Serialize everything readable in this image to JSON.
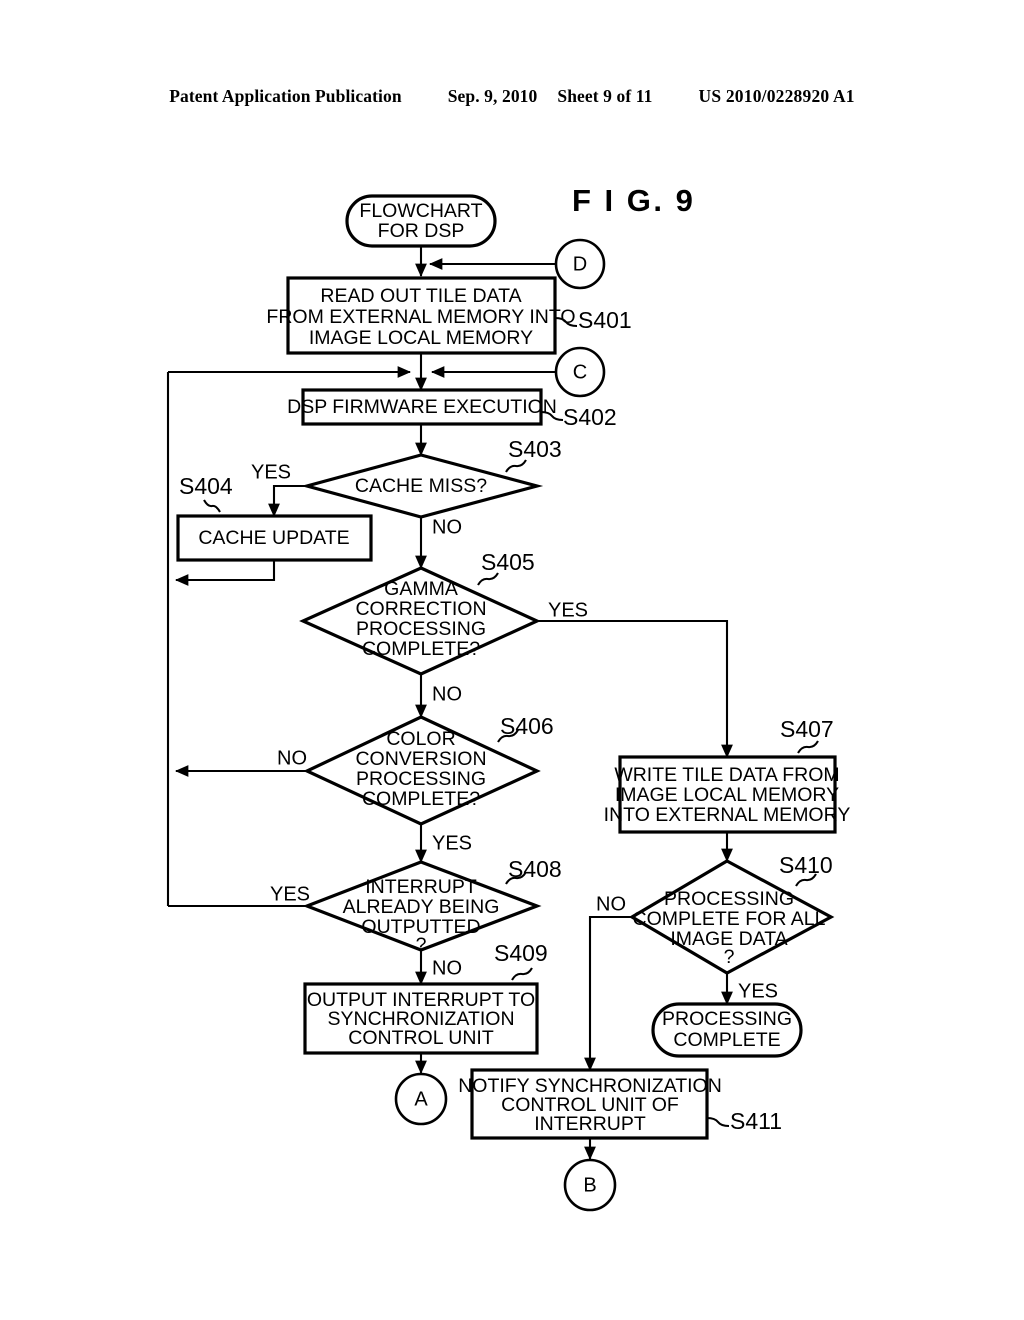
{
  "header": {
    "publication": "Patent Application Publication",
    "date": "Sep. 9, 2010",
    "sheet": "Sheet 9 of 11",
    "number": "US 2010/0228920 A1"
  },
  "figure": {
    "title": "F I G.  9"
  },
  "flowchart": {
    "start": {
      "id": "start",
      "type": "terminator",
      "label_line1": "FLOWCHART",
      "label_line2": "FOR DSP"
    },
    "end": {
      "id": "end",
      "type": "terminator",
      "label_line1": "PROCESSING",
      "label_line2": "COMPLETE"
    },
    "connectors": [
      {
        "id": "conn-d",
        "label": "D"
      },
      {
        "id": "conn-c",
        "label": "C"
      },
      {
        "id": "conn-a",
        "label": "A"
      },
      {
        "id": "conn-b",
        "label": "B"
      }
    ],
    "steps": [
      {
        "id": "s401",
        "step": "S401",
        "type": "process",
        "lines": [
          "READ OUT TILE DATA",
          "FROM  EXTERNAL MEMORY INTO",
          "IMAGE LOCAL MEMORY"
        ]
      },
      {
        "id": "s402",
        "step": "S402",
        "type": "process",
        "lines": [
          "DSP FIRMWARE EXECUTION"
        ]
      },
      {
        "id": "s403",
        "step": "S403",
        "type": "decision",
        "lines": [
          "CACHE MISS?"
        ],
        "branches": {
          "yes": "YES",
          "no": "NO"
        }
      },
      {
        "id": "s404",
        "step": "S404",
        "type": "process",
        "lines": [
          "CACHE UPDATE"
        ]
      },
      {
        "id": "s405",
        "step": "S405",
        "type": "decision",
        "lines": [
          "GAMMA",
          "CORRECTION",
          "PROCESSING",
          "COMPLETE?"
        ],
        "branches": {
          "yes": "YES",
          "no": "NO"
        }
      },
      {
        "id": "s406",
        "step": "S406",
        "type": "decision",
        "lines": [
          "COLOR",
          "CONVERSION",
          "PROCESSING",
          "COMPLETE?"
        ],
        "branches": {
          "yes": "YES",
          "no": "NO"
        }
      },
      {
        "id": "s407",
        "step": "S407",
        "type": "process",
        "lines": [
          "WRITE TILE DATA FROM",
          "IMAGE LOCAL MEMORY",
          "INTO  EXTERNAL MEMORY"
        ]
      },
      {
        "id": "s408",
        "step": "S408",
        "type": "decision",
        "lines": [
          "INTERRUPT",
          "ALREADY BEING",
          "OUTPUTTED",
          "?"
        ],
        "branches": {
          "yes": "YES",
          "no": "NO"
        }
      },
      {
        "id": "s409",
        "step": "S409",
        "type": "process",
        "lines": [
          "OUTPUT INTERRUPT TO",
          "SYNCHRONIZATION",
          "CONTROL UNIT"
        ]
      },
      {
        "id": "s410",
        "step": "S410",
        "type": "decision",
        "lines": [
          "PROCESSING",
          "COMPLETE FOR ALL",
          "IMAGE DATA",
          "?"
        ],
        "branches": {
          "yes": "YES",
          "no": "NO"
        }
      },
      {
        "id": "s411",
        "step": "S411",
        "type": "process",
        "lines": [
          "NOTIFY SYNCHRONIZATION",
          "CONTROL UNIT OF",
          "INTERRUPT"
        ]
      }
    ],
    "colors": {
      "stroke": "#000000",
      "fill": "#ffffff",
      "text": "#000000"
    }
  }
}
